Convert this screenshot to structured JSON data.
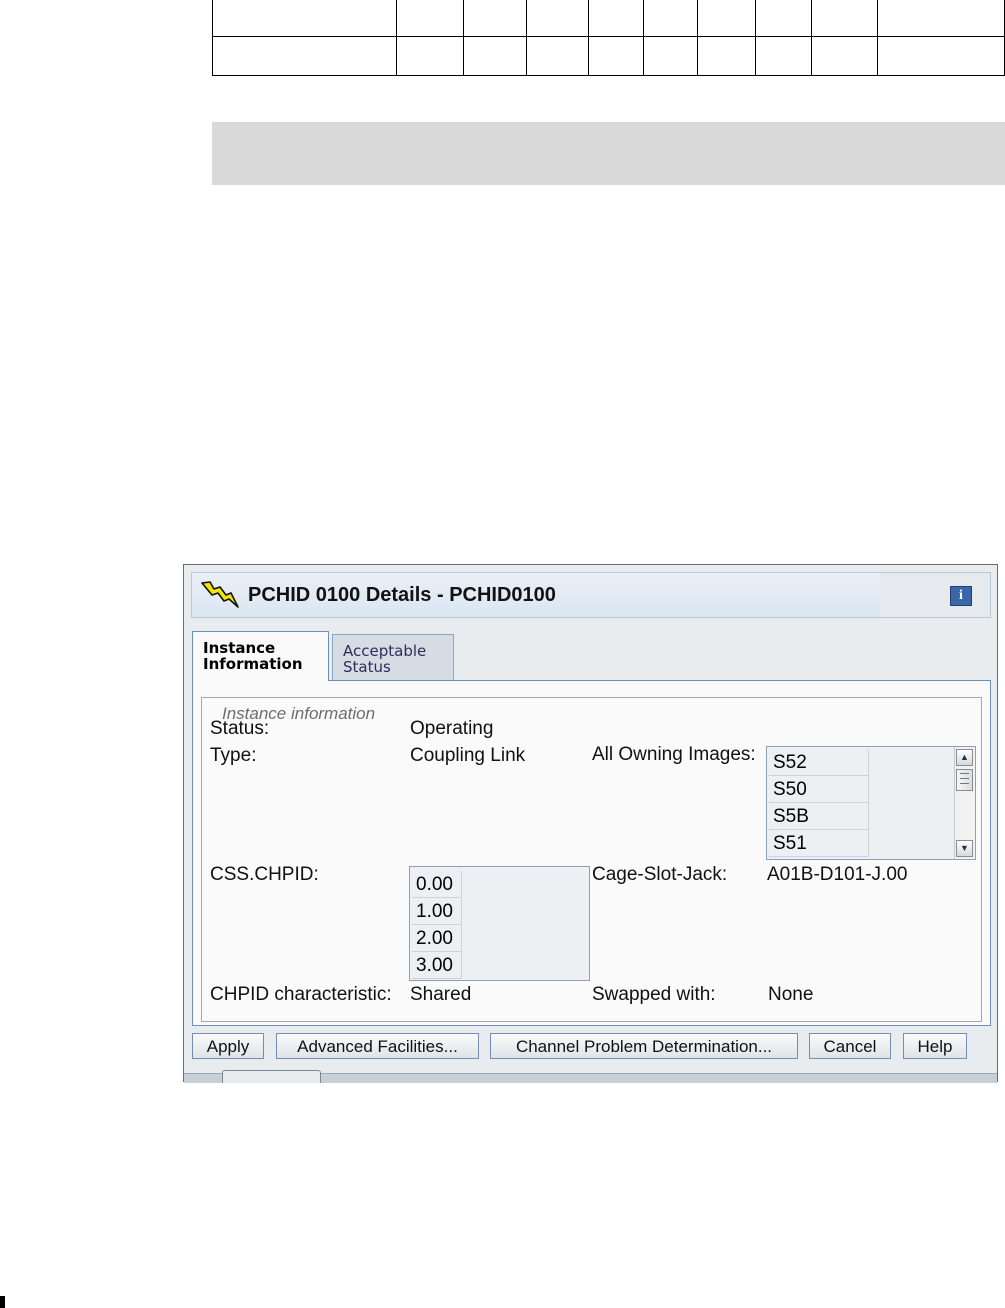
{
  "dialog": {
    "title": "PCHID 0100 Details - PCHID0100",
    "info_icon_text": "i",
    "tabs": [
      {
        "label_line1": "Instance",
        "label_line2": "Information",
        "selected": true
      },
      {
        "label_line1": "Acceptable",
        "label_line2": "Status",
        "selected": false
      }
    ],
    "group_label": "Instance information",
    "fields": {
      "status_label": "Status:",
      "status_value": "Operating",
      "type_label": "Type:",
      "type_value": "Coupling Link",
      "owning_images_label": "All Owning Images:",
      "owning_images": [
        "S52",
        "S50",
        "S5B",
        "S51"
      ],
      "css_chpid_label": "CSS.CHPID:",
      "css_chpids": [
        "0.00",
        "1.00",
        "2.00",
        "3.00"
      ],
      "cage_slot_jack_label": "Cage-Slot-Jack:",
      "cage_slot_jack_value": "A01B-D101-J.00",
      "chpid_char_label": "CHPID characteristic:",
      "chpid_char_value": "Shared",
      "swapped_label": "Swapped with:",
      "swapped_value": "None"
    },
    "buttons": {
      "apply": "Apply",
      "advanced": "Advanced Facilities...",
      "channel_pd": "Channel Problem Determination...",
      "cancel": "Cancel",
      "help": "Help"
    }
  },
  "colors": {
    "title_bar": "#dbe6f2",
    "tab_border": "#6f8fb6",
    "info_button": "#3b66a8",
    "bolt": "#f2e600"
  },
  "icons": [
    "lightning-bolt-icon",
    "info-icon",
    "scroll-up-arrow-icon",
    "scroll-down-arrow-icon"
  ]
}
